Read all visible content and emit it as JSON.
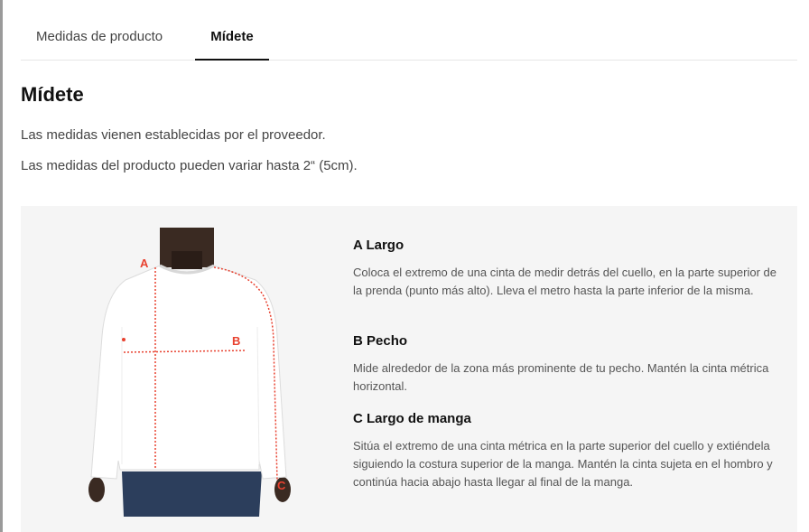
{
  "tabs": [
    {
      "label": "Medidas de producto",
      "active": false
    },
    {
      "label": "Mídete",
      "active": true
    }
  ],
  "title": "Mídete",
  "paragraphs": [
    "Las medidas vienen establecidas por el proveedor.",
    "Las medidas del producto pueden variar hasta 2“ (5cm)."
  ],
  "figure": {
    "labels": {
      "a": "A",
      "b": "B",
      "c": "C"
    },
    "marker_color": "#e8412f",
    "image": "sweatshirt-model-photo"
  },
  "measurements": [
    {
      "heading": "A Largo",
      "text": "Coloca el extremo de una cinta de medir detrás del cuello, en la parte superior de la prenda (punto más alto). Lleva el metro hasta la parte inferior de la misma."
    },
    {
      "heading": "B Pecho",
      "text": "Mide alrededor de la zona más prominente de tu pecho. Mantén la cinta métrica horizontal."
    },
    {
      "heading": "C Largo de manga",
      "text": "Sitúa el extremo de una cinta métrica en la parte superior del cuello y extiéndela siguiendo la costura superior de la manga. Mantén la cinta sujeta en el hombro y continúa hacia abajo hasta llegar al final de la manga."
    }
  ]
}
